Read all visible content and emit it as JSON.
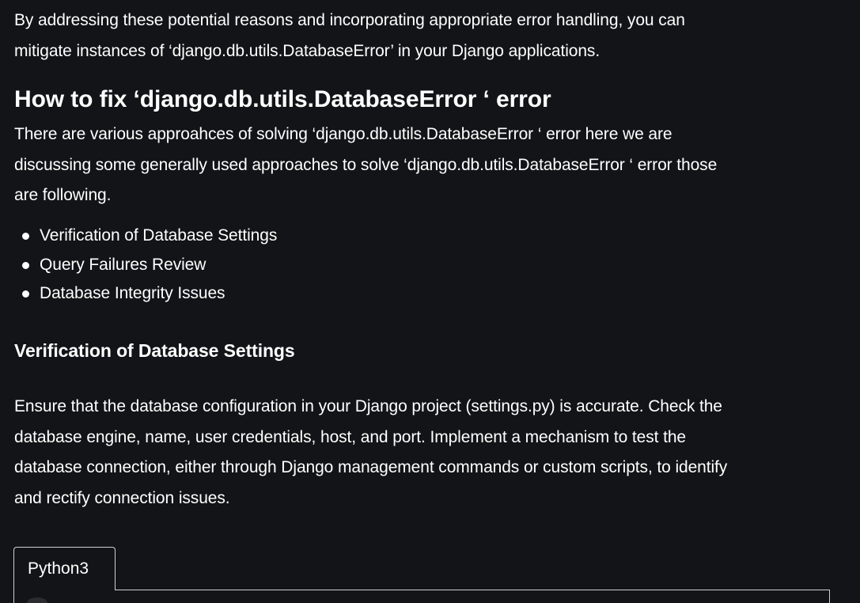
{
  "article": {
    "intro_line1": "By addressing these potential reasons and incorporating appropriate error handling, you can",
    "intro_line2": "mitigate instances of ‘django.db.utils.DatabaseError’ in your Django applications.",
    "section_title": "How to fix ‘django.db.utils.DatabaseError ‘ error",
    "approaches_line1": "There are various approahces of solving ‘django.db.utils.DatabaseError ‘ error here we are",
    "approaches_line2": "discussing some generally used approaches to solve ‘django.db.utils.DatabaseError ‘ error those",
    "approaches_line3": "are following.",
    "bullets": [
      "Verification of Database Settings",
      "Query Failures Review",
      "Database Integrity Issues"
    ],
    "subsection_title": "Verification of Database Settings",
    "ensure_line1": "Ensure that the database configuration in your Django project (settings.py) is accurate. Check the",
    "ensure_line2": "database engine, name, user credentials, host, and port. Implement a mechanism to test the",
    "ensure_line3": "database connection, either through Django management commands or custom scripts, to identify",
    "ensure_line4": "and rectify connection issues."
  },
  "code_block": {
    "tab_label": "Python3"
  },
  "colors": {
    "background": "#131417",
    "text": "#ffffff",
    "border": "#cfcfcf"
  }
}
